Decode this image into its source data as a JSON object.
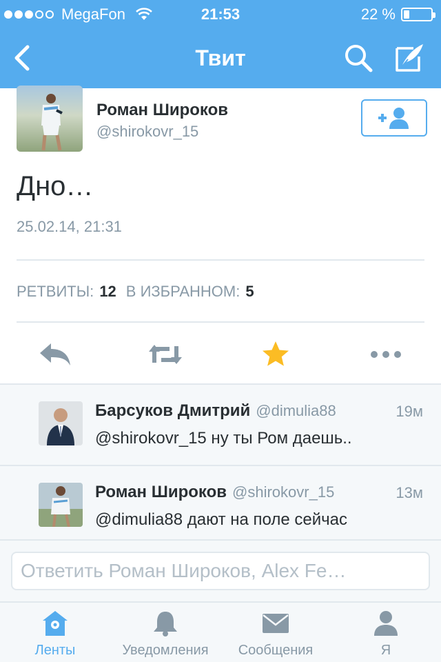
{
  "status_bar": {
    "carrier": "MegaFon",
    "time": "21:53",
    "battery_text": "22 %",
    "battery_level": 0.22,
    "signal_bars_filled": 3,
    "signal_bars_total": 5
  },
  "nav": {
    "title": "Твит",
    "back_icon": "chevron-left-icon",
    "search_icon": "search-icon",
    "compose_icon": "compose-icon"
  },
  "tweet": {
    "author_name": "Роман Широков",
    "author_handle": "@shirokovr_15",
    "text": "Дно…",
    "timestamp": "25.02.14, 21:31",
    "retweets_label": "РЕТВИТЫ:",
    "retweets_count": "12",
    "favorites_label": "В ИЗБРАННОМ:",
    "favorites_count": "5",
    "follow_icon": "add-user-icon",
    "actions": [
      "reply-icon",
      "retweet-icon",
      "favorite-icon",
      "more-icon"
    ]
  },
  "replies": [
    {
      "name": "Барсуков Дмитрий",
      "handle": "@dimulia88",
      "ago": "19м",
      "text": "@shirokovr_15 ну ты Ром даешь.."
    },
    {
      "name": "Роман Широков",
      "handle": "@shirokovr_15",
      "ago": "13м",
      "text": "@dimulia88 дают на поле сейчас"
    }
  ],
  "reply_box": {
    "placeholder": "Ответить Роман Широков, Alex Fe…"
  },
  "tabs": [
    {
      "label": "Ленты",
      "icon": "home-icon",
      "active": true
    },
    {
      "label": "Уведомления",
      "icon": "bell-icon",
      "active": false
    },
    {
      "label": "Сообщения",
      "icon": "envelope-icon",
      "active": false
    },
    {
      "label": "Я",
      "icon": "profile-icon",
      "active": false
    }
  ],
  "colors": {
    "brand": "#55acee",
    "favorite": "#fbbc24",
    "muted": "#8899a6",
    "text": "#292f33"
  }
}
